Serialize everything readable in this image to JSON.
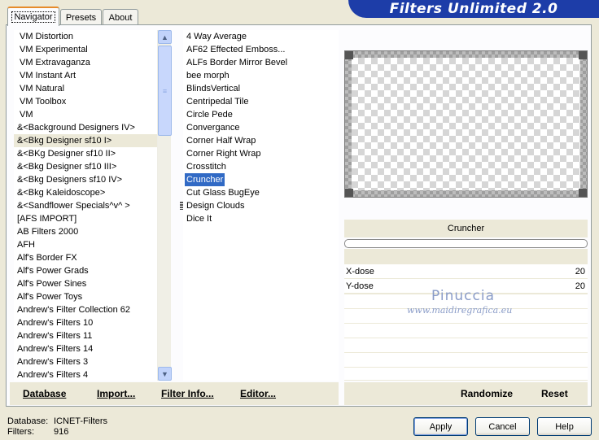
{
  "window": {
    "title": "Filters Unlimited 2.0"
  },
  "tabs": [
    {
      "label": "Navigator"
    },
    {
      "label": "Presets"
    },
    {
      "label": "About"
    }
  ],
  "categories": [
    "VM Distortion",
    "VM Experimental",
    "VM Extravaganza",
    "VM Instant Art",
    "VM Natural",
    "VM Toolbox",
    "VM",
    "&<Background Designers IV>",
    "&<Bkg Designer sf10 I>",
    "&<BKg Designer sf10 II>",
    "&<Bkg Designer sf10 III>",
    "&<Bkg Designers sf10 IV>",
    "&<Bkg Kaleidoscope>",
    "&<Sandflower Specials^v^ >",
    "[AFS IMPORT]",
    "AB Filters 2000",
    "AFH",
    "Alf's Border FX",
    "Alf's Power Grads",
    "Alf's Power Sines",
    "Alf's Power Toys",
    "Andrew's Filter Collection 62",
    "Andrew's Filters 10",
    "Andrew's Filters 11",
    "Andrew's Filters 14",
    "Andrew's Filters 3",
    "Andrew's Filters 4"
  ],
  "filters": [
    "4 Way Average",
    "AF62 Effected Emboss...",
    "ALFs Border Mirror Bevel",
    "bee morph",
    "BlindsVertical",
    "Centripedal Tile",
    "Circle Pede",
    "Convergance",
    "Corner Half Wrap",
    "Corner Right Wrap",
    "Crosstitch",
    "Cruncher",
    "Cut Glass  BugEye",
    "Design Clouds",
    "Dice It"
  ],
  "selected_filter": "Cruncher",
  "params": [
    {
      "label": "X-dose",
      "value": "20"
    },
    {
      "label": "Y-dose",
      "value": "20"
    }
  ],
  "bottom_buttons": {
    "database": "Database",
    "import": "Import...",
    "filter_info": "Filter Info...",
    "editor": "Editor...",
    "randomize": "Randomize",
    "reset": "Reset"
  },
  "footer": {
    "database_label": "Database:",
    "database_value": "ICNET-Filters",
    "filters_label": "Filters:",
    "filters_value": "916"
  },
  "dialog_buttons": {
    "apply": "Apply",
    "cancel": "Cancel",
    "help": "Help"
  },
  "watermark": {
    "name": "Pinuccia",
    "url": "www.maidiregrafica.eu"
  },
  "colors": {
    "banner": "#1d3da8",
    "selection": "#316ac5",
    "panel_bg": "#ece9d8"
  }
}
